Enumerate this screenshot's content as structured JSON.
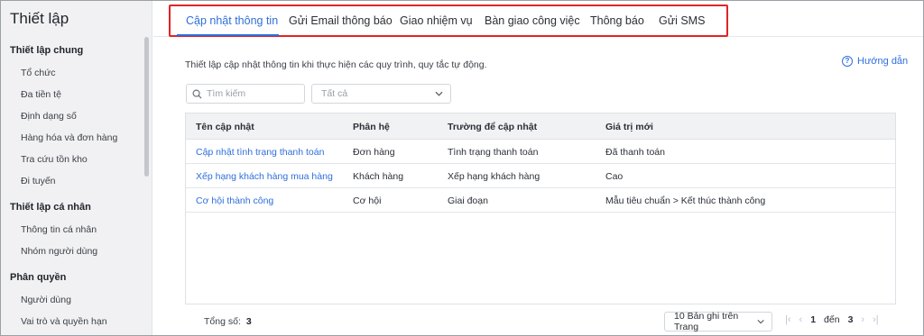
{
  "sidebar": {
    "title": "Thiết lập",
    "groups": [
      {
        "label": "Thiết lập chung",
        "items": [
          "Tổ chức",
          "Đa tiền tệ",
          "Định dạng số",
          "Hàng hóa và đơn hàng",
          "Tra cứu tồn kho",
          "Đi tuyến"
        ]
      },
      {
        "label": "Thiết lập cá nhân",
        "items": [
          "Thông tin cá nhân",
          "Nhóm người dùng"
        ]
      },
      {
        "label": "Phân quyền",
        "items": [
          "Người dùng",
          "Vai trò và quyền hạn"
        ]
      }
    ]
  },
  "tabs": [
    {
      "label": "Cập nhật thông tin",
      "active": true
    },
    {
      "label": "Gửi Email thông báo",
      "active": false
    },
    {
      "label": "Giao nhiệm vụ",
      "active": false
    },
    {
      "label": "Bàn giao công việc",
      "active": false
    },
    {
      "label": "Thông báo",
      "active": false
    },
    {
      "label": "Gửi SMS",
      "active": false
    }
  ],
  "description": "Thiết lập cập nhật thông tin khi thực hiện các quy trình, quy tắc tự động.",
  "help_label": "Hướng dẫn",
  "search": {
    "placeholder": "Tìm kiếm"
  },
  "filter": {
    "selected": "Tất cả"
  },
  "table": {
    "columns": [
      "Tên cập nhật",
      "Phân hệ",
      "Trường để cập nhật",
      "Giá trị mới"
    ],
    "rows": [
      [
        "Cập nhật tình trạng thanh toán",
        "Đơn hàng",
        "Tình trạng thanh toán",
        "Đã thanh toán"
      ],
      [
        "Xếp hạng khách hàng mua hàng",
        "Khách hàng",
        "Xếp hạng khách hàng",
        "Cao"
      ],
      [
        "Cơ hội thành công",
        "Cơ hội",
        "Giai đoạn",
        "Mẫu tiêu chuẩn > Kết thúc thành công"
      ]
    ]
  },
  "footer": {
    "total_label": "Tổng số:",
    "total_value": "3",
    "page_size": "10 Bản ghi trên Trang",
    "page_from": "1",
    "page_to_label": "đến",
    "page_to": "3"
  },
  "colors": {
    "accent": "#2f6fdb",
    "highlight_box": "#e02424",
    "sidebar_bg": "#f1f1f3"
  }
}
